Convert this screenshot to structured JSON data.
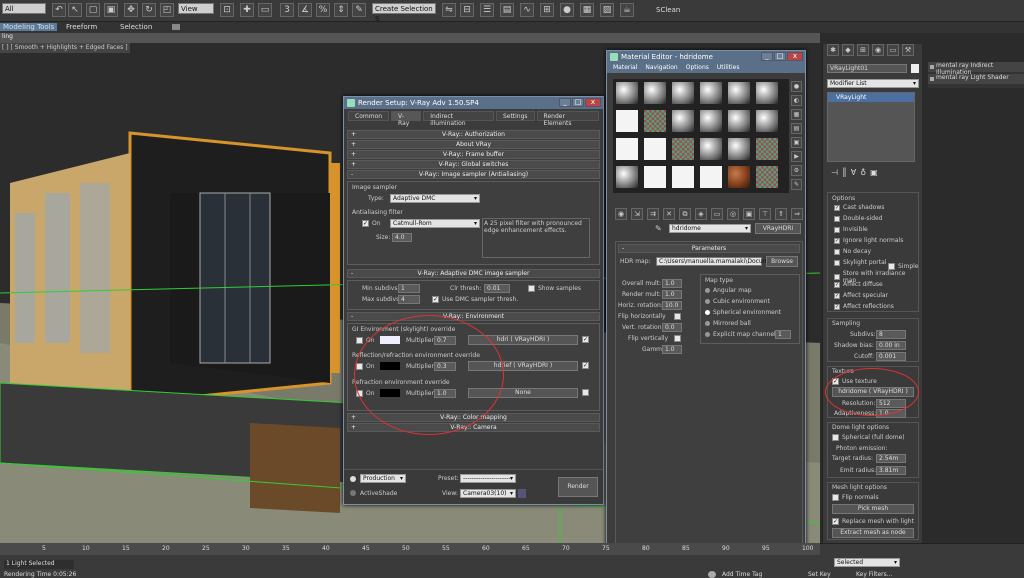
{
  "toolbar": {
    "selection_filter": "All",
    "ref_coord": "View",
    "named_selection": "Create Selection S",
    "user_tag": "SClean"
  },
  "ribbon": {
    "tabs": [
      "Modeling Tools",
      "Freeform",
      "Selection"
    ],
    "sub": "ling"
  },
  "viewport": {
    "label": "[ ] [ Smooth + Highlights + Edged Faces ]"
  },
  "render_setup": {
    "title": "Render Setup: V-Ray Adv 1.50.SP4",
    "tabs": [
      "Common",
      "V-Ray",
      "Indirect illumination",
      "Settings",
      "Render Elements"
    ],
    "rollouts": [
      "V-Ray:: Authorization",
      "About VRay",
      "V-Ray:: Frame buffer",
      "V-Ray:: Global switches",
      "V-Ray:: Image sampler (Antialiasing)"
    ],
    "image_sampler": {
      "group": "Image sampler",
      "type_label": "Type:",
      "type_value": "Adaptive DMC",
      "aa_group": "Antialiasing filter",
      "on_label": "On",
      "filter_value": "Catmull-Rom",
      "filter_desc": "A 25 pixel filter with pronounced edge enhancement effects.",
      "size_label": "Size:",
      "size_value": "4.0"
    },
    "dmc": {
      "title": "V-Ray:: Adaptive DMC image sampler",
      "min_label": "Min subdivs:",
      "min_value": "1",
      "max_label": "Max subdivs:",
      "max_value": "4",
      "clr_label": "Clr thresh:",
      "clr_value": "0.01",
      "show_samples": "Show samples",
      "use_dmc": "Use DMC sampler thresh."
    },
    "environment": {
      "title": "V-Ray:: Environment",
      "gi_group": "GI Environment (skylight) override",
      "on": "On",
      "multiplier": "Multiplier:",
      "gi_mult": "0.7",
      "gi_map": "hdri ( VRayHDRI )",
      "refl_group": "Reflection/refraction environment override",
      "refl_mult": "0.3",
      "refl_map": "hdrief ( VRayHDRI )",
      "refr_group": "Refraction environment override",
      "refr_mult": "1.0",
      "refr_map": "None"
    },
    "bottom_rollouts": [
      "V-Ray:: Color mapping",
      "V-Ray:: Camera"
    ],
    "footer": {
      "production": "Production",
      "activeshade": "ActiveShade",
      "preset_label": "Preset:",
      "preset_value": "----------------------",
      "view_label": "View:",
      "view_value": "Camera03(10)",
      "render_button": "Render"
    }
  },
  "material_editor": {
    "title": "Material Editor - hdridome",
    "menu": [
      "Material",
      "Navigation",
      "Options",
      "Utilities"
    ],
    "material_name": "hdridome",
    "material_type": "VRayHDRI",
    "params_title": "Parameters",
    "hdr_label": "HDR map:",
    "hdr_path": "C:\\Users\\manuella.mamalaki\\Docume",
    "browse": "Browse",
    "overall_label": "Overall mult:",
    "overall_value": "1.0",
    "render_label": "Render mult:",
    "render_value": "1.0",
    "horiz_label": "Horiz. rotation:",
    "horiz_value": "10.0",
    "flip_h": "Flip horizontally",
    "vert_label": "Vert. rotation:",
    "vert_value": "0.0",
    "flip_v": "Flip vertically",
    "gamma_label": "Gamma:",
    "gamma_value": "1.0",
    "map_type_title": "Map type",
    "map_types": [
      "Angular map",
      "Cubic environment",
      "Spherical environment",
      "Mirrored ball",
      "Explicit map channel"
    ],
    "map_channel": "1"
  },
  "modify_panel": {
    "object_name": "VRayLight01",
    "modifier_list": "Modifier List",
    "stack_item": "VRayLight",
    "options_title": "Options",
    "options": [
      {
        "label": "Cast shadows",
        "checked": true
      },
      {
        "label": "Double-sided",
        "checked": false
      },
      {
        "label": "Invisible",
        "checked": false
      },
      {
        "label": "Ignore light normals",
        "checked": true
      },
      {
        "label": "No decay",
        "checked": false
      },
      {
        "label": "Skylight portal",
        "checked": false
      },
      {
        "label": "Store with irradiance map",
        "checked": false
      },
      {
        "label": "Affect diffuse",
        "checked": true
      },
      {
        "label": "Affect specular",
        "checked": true
      },
      {
        "label": "Affect reflections",
        "checked": true
      }
    ],
    "simple": "Simple",
    "sampling_title": "Sampling",
    "subdivs_label": "Subdivs:",
    "subdivs_value": "8",
    "shadow_bias_label": "Shadow bias:",
    "shadow_bias_value": "0.00 in",
    "cutoff_label": "Cutoff:",
    "cutoff_value": "0.001",
    "texture_title": "Texture",
    "use_texture": "Use texture",
    "texture_name": "hdridome ( VRayHDRI )",
    "resolution_label": "Resolution:",
    "resolution_value": "512",
    "adaptiveness_label": "Adaptiveness:",
    "adaptiveness_value": "1.0",
    "dome_title": "Dome light options",
    "spherical": "Spherical (full dome)",
    "photon": "Photon emission:",
    "target_label": "Target radius:",
    "target_value": "2.54m",
    "emit_label": "Emit radius:",
    "emit_value": "3.81m",
    "mesh_title": "Mesh light options",
    "flip_normals": "Flip normals",
    "pick_mesh": "Pick mesh",
    "replace_mesh": "Replace mesh with light",
    "extract_mesh": "Extract mesh as node"
  },
  "scene_explorer": {
    "items": [
      "mental ray Indirect Illumination",
      "mental ray Light Shader"
    ]
  },
  "timeline": {
    "ticks": [
      "5",
      "10",
      "15",
      "20",
      "25",
      "30",
      "35",
      "40",
      "45",
      "50",
      "55",
      "60",
      "65",
      "70",
      "75",
      "80",
      "85",
      "90",
      "95",
      "100"
    ]
  },
  "status": {
    "selected": "1 Light Selected",
    "render_time": "Rendering Time  0:05:26",
    "add_time_tag": "Add Time Tag",
    "set_key": "Set Key",
    "selected_dropdown": "Selected",
    "key_filters": "Key Filters..."
  }
}
